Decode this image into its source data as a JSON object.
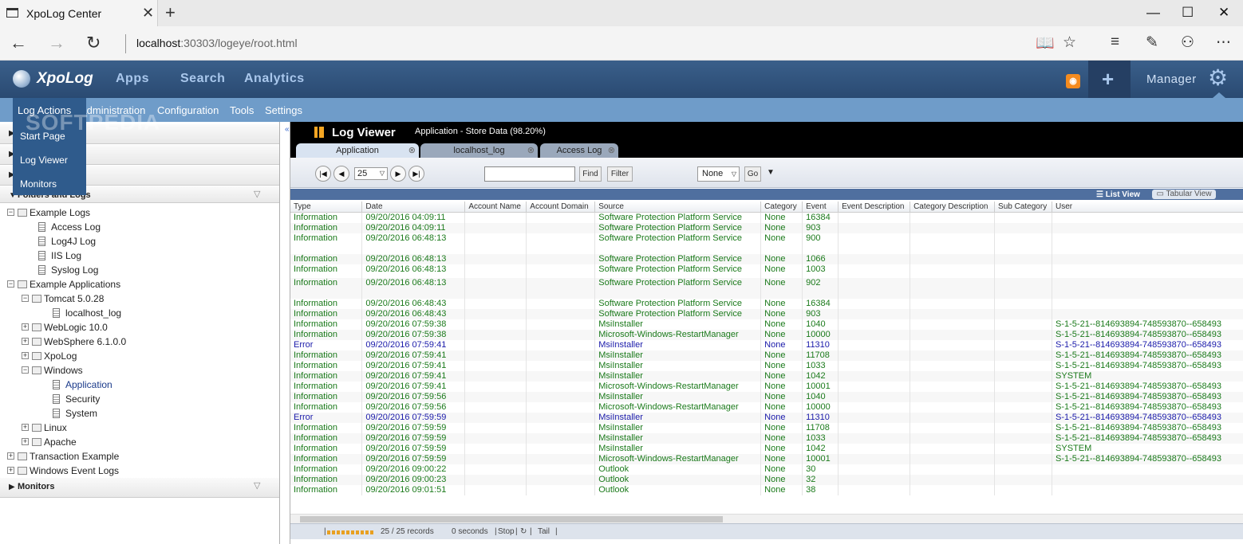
{
  "browser": {
    "tab_title": "XpoLog Center",
    "url_host": "localhost",
    "url_rest": ":30303/logeye/root.html"
  },
  "app": {
    "logo": "XpoLog",
    "nav": [
      "Apps",
      "Search",
      "Analytics"
    ],
    "manager_label": "Manager",
    "submenu": [
      "Log Actions",
      "Administration",
      "Configuration",
      "Tools",
      "Settings"
    ],
    "dropdown": [
      "Start Page",
      "Log Viewer",
      "Monitors"
    ],
    "watermark": "SOFTPEDIA"
  },
  "left_panel": {
    "section_title": "Folders and Logs",
    "monitors_title": "Monitors",
    "tree": [
      {
        "label": "Example Logs",
        "level": 0,
        "kind": "folder",
        "state": "-"
      },
      {
        "label": "Access Log",
        "level": 1,
        "kind": "log"
      },
      {
        "label": "Log4J Log",
        "level": 1,
        "kind": "log"
      },
      {
        "label": "IIS Log",
        "level": 1,
        "kind": "log"
      },
      {
        "label": "Syslog Log",
        "level": 1,
        "kind": "log"
      },
      {
        "label": "Example Applications",
        "level": 0,
        "kind": "folder",
        "state": "-"
      },
      {
        "label": "Tomcat 5.0.28",
        "level": 1,
        "kind": "folder",
        "state": "-"
      },
      {
        "label": "localhost_log",
        "level": 2,
        "kind": "log"
      },
      {
        "label": "WebLogic 10.0",
        "level": 1,
        "kind": "folder",
        "state": "+"
      },
      {
        "label": "WebSphere 6.1.0.0",
        "level": 1,
        "kind": "folder",
        "state": "+"
      },
      {
        "label": "XpoLog",
        "level": 1,
        "kind": "folder",
        "state": "+"
      },
      {
        "label": "Windows",
        "level": 1,
        "kind": "folder",
        "state": "-"
      },
      {
        "label": "Application",
        "level": 2,
        "kind": "log",
        "selected": true
      },
      {
        "label": "Security",
        "level": 2,
        "kind": "log"
      },
      {
        "label": "System",
        "level": 2,
        "kind": "log"
      },
      {
        "label": "Linux",
        "level": 1,
        "kind": "folder",
        "state": "+"
      },
      {
        "label": "Apache",
        "level": 1,
        "kind": "folder",
        "state": "+"
      },
      {
        "label": "Transaction Example",
        "level": 0,
        "kind": "folder",
        "state": "+"
      },
      {
        "label": "Windows Event Logs",
        "level": 0,
        "kind": "folder",
        "state": "+"
      }
    ]
  },
  "viewer": {
    "title": "Log Viewer",
    "subtitle": "Application  - Store Data (98.20%)",
    "tabs": [
      "Application",
      "localhost_log",
      "Access Log"
    ],
    "page_size": "25",
    "find_label": "Find",
    "filter_label": "Filter",
    "none_label": "None",
    "go_label": "Go",
    "list_view": "List View",
    "tabular_view": "Tabular View",
    "columns": [
      "Type",
      "Date",
      "Account Name",
      "Account Domain",
      "Source",
      "Category",
      "Event",
      "Event Description",
      "Category Description",
      "Sub Category",
      "User"
    ],
    "rows": [
      {
        "h": "n",
        "type": "Information",
        "date": "09/20/2016 04:09:11",
        "source": "Software Protection Platform Service",
        "category": "None",
        "event": "16384",
        "user": ""
      },
      {
        "h": "n",
        "type": "Information",
        "date": "09/20/2016 04:09:11",
        "source": "Software Protection Platform Service",
        "category": "None",
        "event": "903",
        "user": ""
      },
      {
        "h": "tall",
        "type": "Information",
        "date": "09/20/2016 06:48:13",
        "source": "Software Protection Platform Service",
        "category": "None",
        "event": "900",
        "user": ""
      },
      {
        "h": "n",
        "type": "Information",
        "date": "09/20/2016 06:48:13",
        "source": "Software Protection Platform Service",
        "category": "None",
        "event": "1066",
        "user": ""
      },
      {
        "h": "mid",
        "type": "Information",
        "date": "09/20/2016 06:48:13",
        "source": "Software Protection Platform Service",
        "category": "None",
        "event": "1003",
        "user": ""
      },
      {
        "h": "tall",
        "type": "Information",
        "date": "09/20/2016 06:48:13",
        "source": "Software Protection Platform Service",
        "category": "None",
        "event": "902",
        "user": ""
      },
      {
        "h": "n",
        "type": "Information",
        "date": "09/20/2016 06:48:43",
        "source": "Software Protection Platform Service",
        "category": "None",
        "event": "16384",
        "user": ""
      },
      {
        "h": "n",
        "type": "Information",
        "date": "09/20/2016 06:48:43",
        "source": "Software Protection Platform Service",
        "category": "None",
        "event": "903",
        "user": ""
      },
      {
        "h": "n",
        "type": "Information",
        "date": "09/20/2016 07:59:38",
        "source": "MsiInstaller",
        "category": "None",
        "event": "1040",
        "user": "S-1-5-21--814693894-748593870--658493"
      },
      {
        "h": "n",
        "type": "Information",
        "date": "09/20/2016 07:59:38",
        "source": "Microsoft-Windows-RestartManager",
        "category": "None",
        "event": "10000",
        "user": "S-1-5-21--814693894-748593870--658493"
      },
      {
        "h": "n",
        "err": true,
        "type": "Error",
        "date": "09/20/2016 07:59:41",
        "source": "MsiInstaller",
        "category": "None",
        "event": "11310",
        "user": "S-1-5-21--814693894-748593870--658493"
      },
      {
        "h": "n",
        "type": "Information",
        "date": "09/20/2016 07:59:41",
        "source": "MsiInstaller",
        "category": "None",
        "event": "11708",
        "user": "S-1-5-21--814693894-748593870--658493"
      },
      {
        "h": "n",
        "type": "Information",
        "date": "09/20/2016 07:59:41",
        "source": "MsiInstaller",
        "category": "None",
        "event": "1033",
        "user": "S-1-5-21--814693894-748593870--658493"
      },
      {
        "h": "n",
        "type": "Information",
        "date": "09/20/2016 07:59:41",
        "source": "MsiInstaller",
        "category": "None",
        "event": "1042",
        "user": "SYSTEM"
      },
      {
        "h": "n",
        "type": "Information",
        "date": "09/20/2016 07:59:41",
        "source": "Microsoft-Windows-RestartManager",
        "category": "None",
        "event": "10001",
        "user": "S-1-5-21--814693894-748593870--658493"
      },
      {
        "h": "n",
        "type": "Information",
        "date": "09/20/2016 07:59:56",
        "source": "MsiInstaller",
        "category": "None",
        "event": "1040",
        "user": "S-1-5-21--814693894-748593870--658493"
      },
      {
        "h": "n",
        "type": "Information",
        "date": "09/20/2016 07:59:56",
        "source": "Microsoft-Windows-RestartManager",
        "category": "None",
        "event": "10000",
        "user": "S-1-5-21--814693894-748593870--658493"
      },
      {
        "h": "n",
        "err": true,
        "type": "Error",
        "date": "09/20/2016 07:59:59",
        "source": "MsiInstaller",
        "category": "None",
        "event": "11310",
        "user": "S-1-5-21--814693894-748593870--658493"
      },
      {
        "h": "n",
        "type": "Information",
        "date": "09/20/2016 07:59:59",
        "source": "MsiInstaller",
        "category": "None",
        "event": "11708",
        "user": "S-1-5-21--814693894-748593870--658493"
      },
      {
        "h": "n",
        "type": "Information",
        "date": "09/20/2016 07:59:59",
        "source": "MsiInstaller",
        "category": "None",
        "event": "1033",
        "user": "S-1-5-21--814693894-748593870--658493"
      },
      {
        "h": "n",
        "type": "Information",
        "date": "09/20/2016 07:59:59",
        "source": "MsiInstaller",
        "category": "None",
        "event": "1042",
        "user": "SYSTEM"
      },
      {
        "h": "n",
        "type": "Information",
        "date": "09/20/2016 07:59:59",
        "source": "Microsoft-Windows-RestartManager",
        "category": "None",
        "event": "10001",
        "user": "S-1-5-21--814693894-748593870--658493"
      },
      {
        "h": "n",
        "type": "Information",
        "date": "09/20/2016 09:00:22",
        "source": "Outlook",
        "category": "None",
        "event": "30",
        "user": ""
      },
      {
        "h": "n",
        "type": "Information",
        "date": "09/20/2016 09:00:23",
        "source": "Outlook",
        "category": "None",
        "event": "32",
        "user": ""
      },
      {
        "h": "n",
        "type": "Information",
        "date": "09/20/2016 09:01:51",
        "source": "Outlook",
        "category": "None",
        "event": "38",
        "user": ""
      }
    ],
    "status": {
      "records": "25 / 25 records",
      "time": "0 seconds",
      "stop": "Stop",
      "tail": "Tail"
    }
  },
  "colors": {
    "header": "#2f5585",
    "submenu": "#6f9cc9",
    "info_text": "#1b7a1b",
    "error_text": "#1a1aaa"
  }
}
